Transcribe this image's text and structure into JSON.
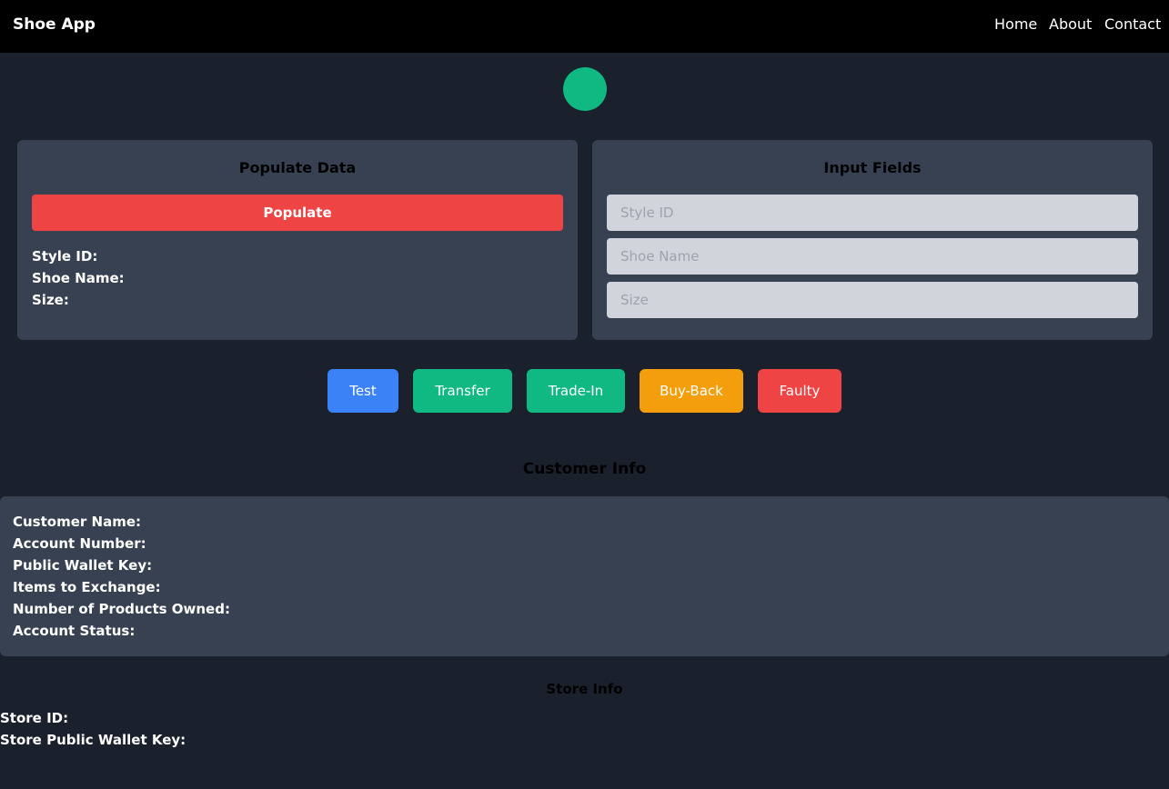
{
  "navbar": {
    "brand": "Shoe App",
    "links": [
      "Home",
      "About",
      "Contact"
    ]
  },
  "status": {
    "color": "#10b981"
  },
  "populate_card": {
    "title": "Populate Data",
    "button_label": "Populate",
    "labels": [
      "Style ID:",
      "Shoe Name:",
      "Size:"
    ]
  },
  "input_card": {
    "title": "Input Fields",
    "placeholders": [
      "Style ID",
      "Shoe Name",
      "Size"
    ]
  },
  "actions": [
    {
      "label": "Test",
      "color": "#3b82f6"
    },
    {
      "label": "Transfer",
      "color": "#10b981"
    },
    {
      "label": "Trade-In",
      "color": "#10b981"
    },
    {
      "label": "Buy-Back",
      "color": "#f59e0b"
    },
    {
      "label": "Faulty",
      "color": "#ef4444"
    }
  ],
  "customer_info": {
    "title": "Customer Info",
    "labels": [
      "Customer Name:",
      "Account Number:",
      "Public Wallet Key:",
      "Items to Exchange:",
      "Number of Products Owned:",
      "Account Status:"
    ]
  },
  "store_info": {
    "title": "Store Info",
    "labels": [
      "Store ID:",
      "Store Public Wallet Key:"
    ]
  }
}
